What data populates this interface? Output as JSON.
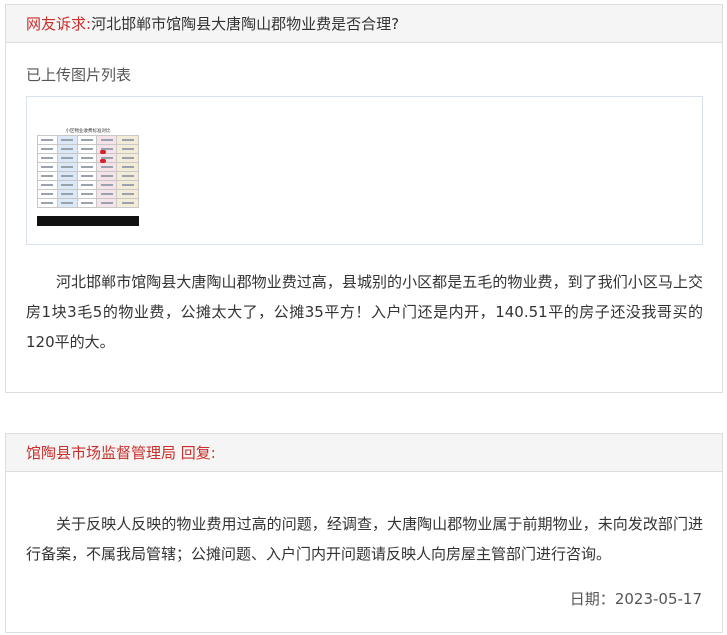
{
  "complaint": {
    "label": "网友诉求:",
    "title": "河北邯郸市馆陶县大唐陶山郡物业费是否合理?",
    "uploaded_label": "已上传图片列表",
    "thumbnail": {
      "title": "小区物业收费标准对比",
      "rows": 8,
      "columns": 5
    },
    "body": "河北邯郸市馆陶县大唐陶山郡物业费过高，县城别的小区都是五毛的物业费，到了我们小区马上交房1块3毛5的物业费，公摊太大了，公摊35平方！入户门还是内开，140.51平的房子还没我哥买的120平的大。"
  },
  "reply": {
    "label": "馆陶县市场监督管理局 回复:",
    "body": "关于反映人反映的物业费用过高的问题，经调查，大唐陶山郡物业属于前期物业，未向发改部门进行备案，不属我局管辖；公摊问题、入户门内开问题请反映人向房屋主管部门进行咨询。",
    "date_label": "日期：",
    "date": "2023-05-17"
  },
  "colors": {
    "accent_red": "#c9302c",
    "panel_header_bg": "#f5f5f5",
    "border": "#dddddd"
  }
}
